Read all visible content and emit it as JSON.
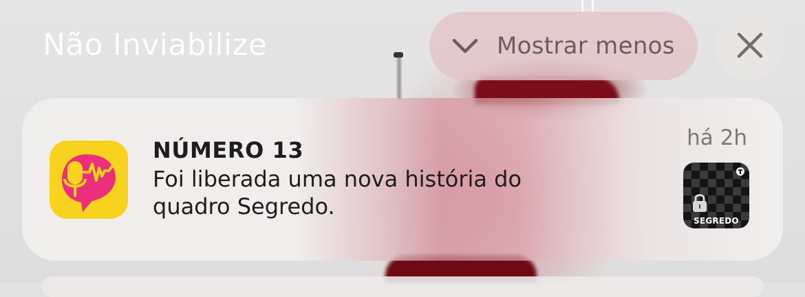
{
  "group": {
    "title": "Não Inviabilize",
    "show_less_label": "Mostrar menos"
  },
  "notification": {
    "app_name": "NÚMERO 13",
    "body_lines": [
      "Foi liberada uma nova história do",
      "quadro Segredo."
    ],
    "time": "há 2h",
    "thumbnail_label": "SEGREDO"
  },
  "icons": {
    "show_less": "chevron-down-icon",
    "close": "close-icon",
    "app": "podcast-microphone-icon",
    "thumbnail_lock": "lock-icon"
  },
  "colors": {
    "app_icon_bg": "#f7d21f",
    "app_icon_accent": "#ec2f7c"
  }
}
